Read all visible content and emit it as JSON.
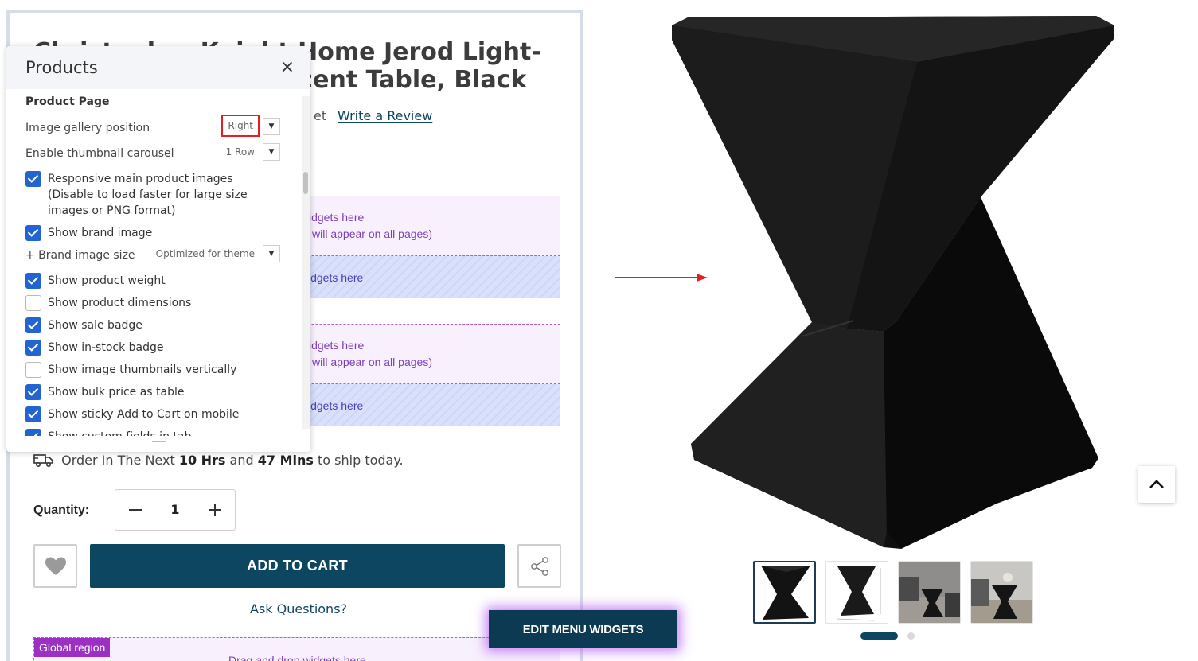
{
  "product": {
    "title_line1": "Christopher Knight Home Jerod Light-",
    "title_line2": "Weight Concrete Accent Table, Black",
    "rating_suffix": "et",
    "write_review": "Write a Review",
    "shipping": {
      "prefix": "Order In The Next",
      "hours": "10 Hrs",
      "and": "and",
      "mins": "47 Mins",
      "suffix": "to ship today."
    },
    "quantity_label": "Quantity:",
    "quantity_value": "1",
    "add_to_cart": "ADD TO CART",
    "ask_questions": "Ask Questions?"
  },
  "drop_zones": [
    {
      "line1": "idgets here",
      "line2": "will appear on all pages)"
    },
    {
      "line1": "idgets here"
    },
    {
      "line1": "idgets here",
      "line2": "will appear on all pages)"
    },
    {
      "line1": "idgets here"
    }
  ],
  "global_region": {
    "tag": "Global region",
    "text": "Drag and drop widgets here"
  },
  "panel": {
    "title": "Products",
    "close": "×",
    "section": "Product Page",
    "image_gallery": {
      "label": "Image gallery position",
      "value": "Right"
    },
    "thumb_carousel": {
      "label": "Enable thumbnail carousel",
      "value": "1 Row"
    },
    "brand_size": {
      "label": "+ Brand image size",
      "value": "Optimized for theme"
    },
    "options": [
      {
        "label": "Responsive main product images (Disable to load faster for large size images or PNG format)",
        "checked": true
      },
      {
        "label": "Show brand image",
        "checked": true
      },
      {
        "label": "Show product weight",
        "checked": true
      },
      {
        "label": "Show product dimensions",
        "checked": false
      },
      {
        "label": "Show sale badge",
        "checked": true
      },
      {
        "label": "Show in-stock badge",
        "checked": true
      },
      {
        "label": "Show image thumbnails vertically",
        "checked": false
      },
      {
        "label": "Show bulk price as table",
        "checked": true
      },
      {
        "label": "Show sticky Add to Cart on mobile",
        "checked": true
      },
      {
        "label": "Show custom fields in tab",
        "checked": true
      }
    ]
  },
  "edit_menu_widgets": "EDIT MENU WIDGETS",
  "colors": {
    "brand": "#0c4660",
    "accent": "#2264d1",
    "highlight": "#e1201f",
    "arrow": "#e1201f",
    "global_tag": "#9b30c2"
  }
}
